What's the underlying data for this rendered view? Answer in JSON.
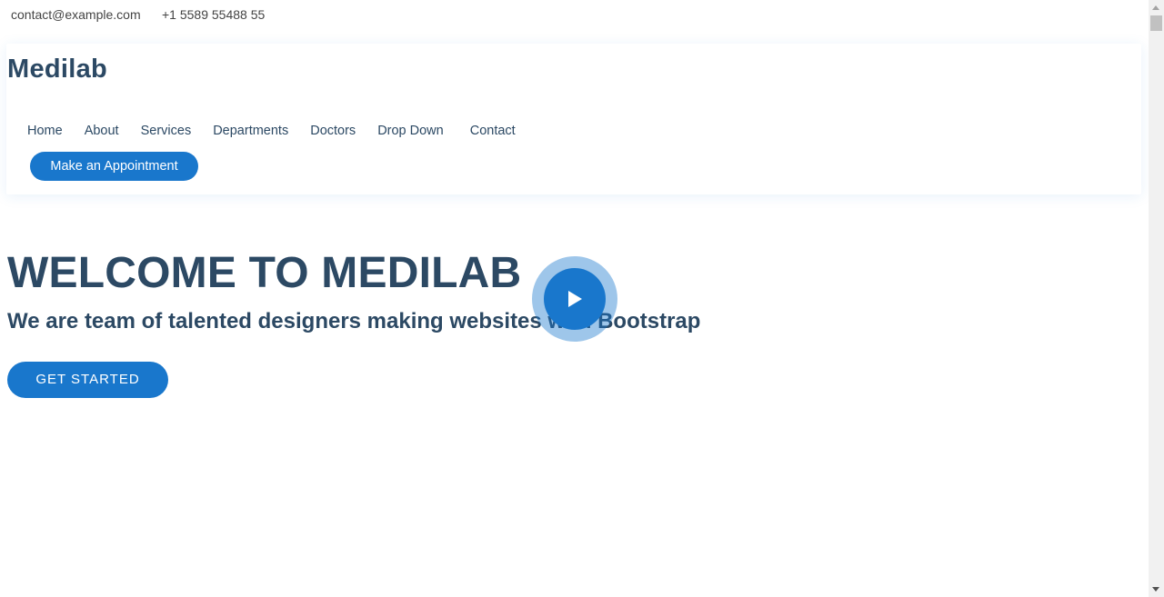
{
  "topbar": {
    "email": "contact@example.com",
    "phone": "+1 5589 55488 55"
  },
  "header": {
    "logo": "Medilab",
    "nav": [
      {
        "label": "Home"
      },
      {
        "label": "About"
      },
      {
        "label": "Services"
      },
      {
        "label": "Departments"
      },
      {
        "label": "Doctors"
      },
      {
        "label": "Drop Down"
      },
      {
        "label": "Contact"
      }
    ],
    "appointment_button": "Make an Appointment"
  },
  "hero": {
    "title": "WELCOME TO MEDILAB",
    "subtitle": "We are team of talented designers making websites with Bootstrap",
    "cta_label": "GET STARTED",
    "video_icon": "play-icon"
  },
  "colors": {
    "accent": "#1977cc",
    "heading": "#2c4964"
  }
}
